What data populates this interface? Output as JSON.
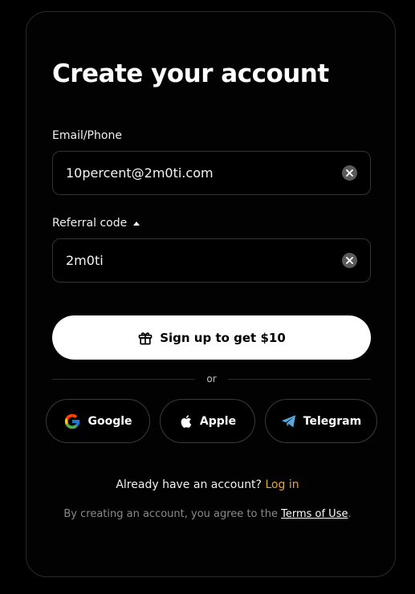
{
  "title": "Create your account",
  "email": {
    "label": "Email/Phone",
    "value": "10percent@2m0ti.com",
    "clear_icon": "clear-icon"
  },
  "referral": {
    "label": "Referral code",
    "value": "2m0ti",
    "toggle_icon": "caret-up-icon",
    "clear_icon": "clear-icon"
  },
  "signup": {
    "label": "Sign up to get $10",
    "icon": "gift-icon"
  },
  "divider": {
    "text": "or"
  },
  "social": {
    "google": "Google",
    "apple": "Apple",
    "telegram": "Telegram"
  },
  "login": {
    "prompt": "Already have an account?",
    "link": "Log in"
  },
  "terms": {
    "prefix": "By creating an account, you agree to the",
    "link": "Terms of Use",
    "suffix": "."
  },
  "colors": {
    "background": "#000000",
    "accent": "#e3a73c",
    "primary_button": "#ffffff"
  }
}
